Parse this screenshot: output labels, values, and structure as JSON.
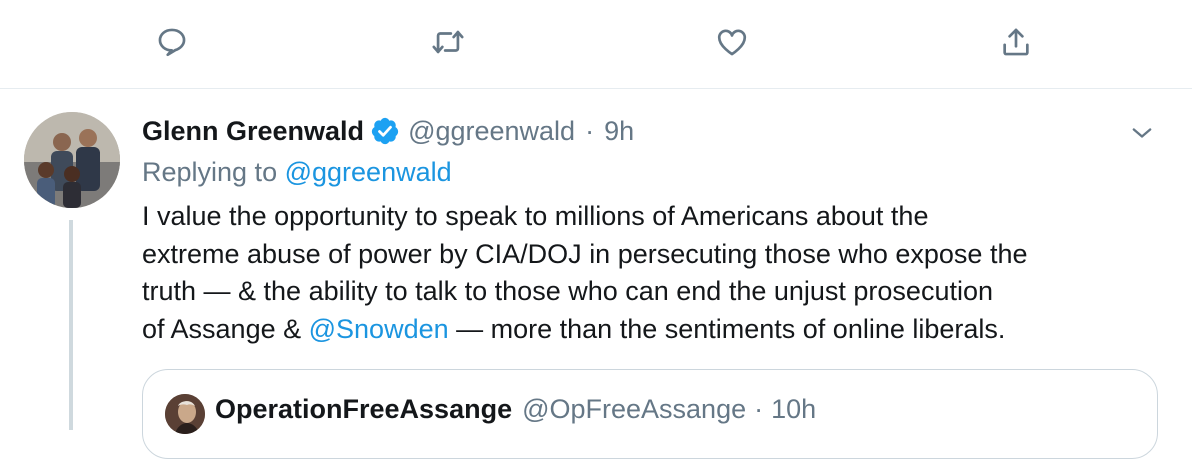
{
  "actions": {
    "reply_icon": "speech-bubble",
    "retweet_icon": "retweet-arrows",
    "like_icon": "heart",
    "share_icon": "upload-arrow"
  },
  "tweet": {
    "author_name": "Glenn Greenwald",
    "handle": "@ggreenwald",
    "separator": "·",
    "time": "9h",
    "replying_prefix": "Replying to",
    "replying_handle": "@ggreenwald",
    "text_line_1": "I value the opportunity to speak to millions of Americans about the",
    "text_line_2": "extreme abuse of power by CIA/DOJ in persecuting those who expose the",
    "text_line_3": "truth — & the ability to talk to those who can end the unjust prosecution",
    "text_line_4_a": "of Assange & ",
    "text_line_4_mention": "@Snowden",
    "text_line_4_b": " — more than the sentiments of online liberals."
  },
  "quote": {
    "author_name": "OperationFreeAssange",
    "handle": "@OpFreeAssange",
    "separator": "·",
    "time": "10h"
  },
  "colors": {
    "link": "#1b95e0",
    "muted": "#657786",
    "text": "#14171a",
    "verified": "#1da1f2",
    "border": "#e6ecf0"
  }
}
